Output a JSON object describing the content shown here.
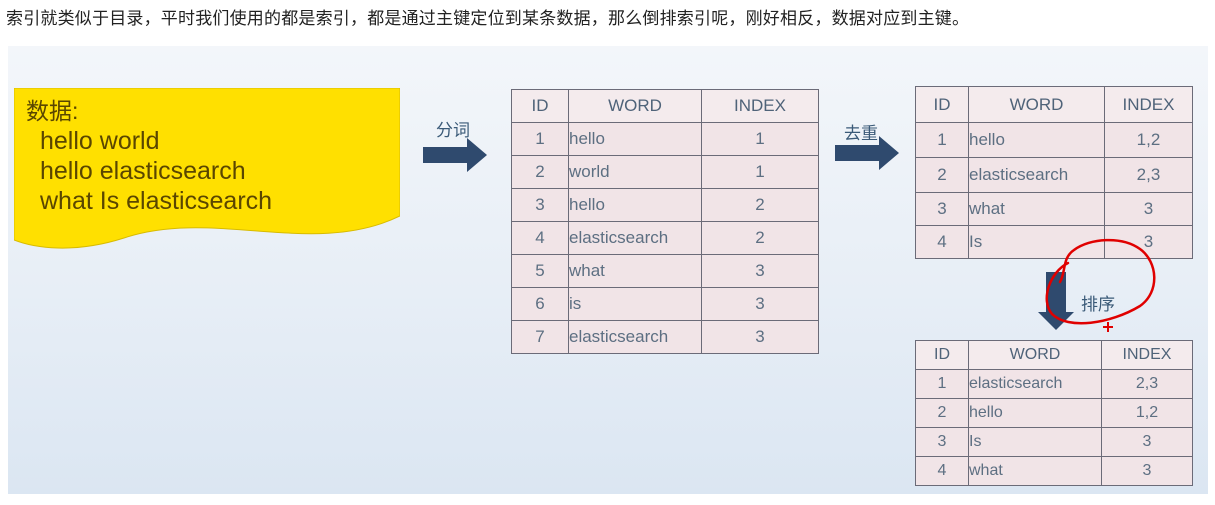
{
  "caption": "索引就类似于目录，平时我们使用的都是索引，都是通过主键定位到某条数据，那么倒排索引呢，刚好相反，数据对应到主键。",
  "note": {
    "title": "数据:",
    "lines": [
      "hello world",
      "hello elasticsearch",
      "what Is elasticsearch"
    ]
  },
  "steps": {
    "tokenize": "分词",
    "dedupe": "去重",
    "sort": "排序"
  },
  "headers": {
    "id": "ID",
    "word": "WORD",
    "index": "INDEX"
  },
  "table1": {
    "rows": [
      {
        "id": "1",
        "word": "hello",
        "index": "1"
      },
      {
        "id": "2",
        "word": "world",
        "index": "1"
      },
      {
        "id": "3",
        "word": "hello",
        "index": "2"
      },
      {
        "id": "4",
        "word": "elasticsearch",
        "index": "2"
      },
      {
        "id": "5",
        "word": "what",
        "index": "3"
      },
      {
        "id": "6",
        "word": "is",
        "index": "3"
      },
      {
        "id": "7",
        "word": "elasticsearch",
        "index": "3"
      }
    ]
  },
  "table2": {
    "rows": [
      {
        "id": "1",
        "word": "hello",
        "index": "1,2"
      },
      {
        "id": "2",
        "word": "elasticsearch",
        "index": "2,3"
      },
      {
        "id": "3",
        "word": "what",
        "index": "3"
      },
      {
        "id": "4",
        "word": "Is",
        "index": "3"
      }
    ]
  },
  "table3": {
    "rows": [
      {
        "id": "1",
        "word": "elasticsearch",
        "index": "2,3"
      },
      {
        "id": "2",
        "word": "hello",
        "index": "1,2"
      },
      {
        "id": "3",
        "word": "Is",
        "index": "3"
      },
      {
        "id": "4",
        "word": "what",
        "index": "3"
      }
    ]
  },
  "colors": {
    "note_fill": "#ffe000",
    "arrow": "#2f4a6e",
    "annotation": "#e00000"
  },
  "icons": [
    "arrow-right-icon",
    "arrow-down-icon"
  ]
}
